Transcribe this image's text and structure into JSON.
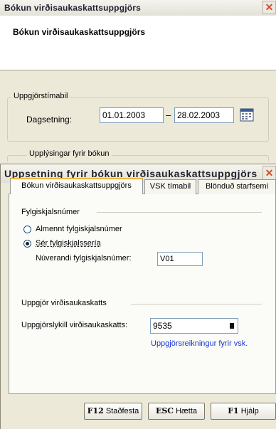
{
  "back_window": {
    "title": "Bókun virðisaukaskattsuppgjörs",
    "heading": "Bókun virðisaukaskattsuppgjörs",
    "period_group": "Uppgjörstímabil",
    "date_label": "Dagsetning:",
    "date_from": "01.01.2003",
    "date_separator": "–",
    "date_to": "28.02.2003",
    "info_group": "Upplýsingar fyrir bókun",
    "side_letter": "s",
    "close_glyph": "✕"
  },
  "dialog": {
    "title": "Uppsetning fyrir bókun virðisaukaskattsuppgjörs",
    "close_glyph": "✕",
    "tabs": [
      {
        "label": "Bókun virðisaukaskattsuppgjörs"
      },
      {
        "label": "VSK tímabil"
      },
      {
        "label": "Blönduð starfsemi"
      }
    ],
    "voucher_section": "Fylgiskjalsnúmer",
    "radio_general": "Almennt fylgiskjalsnúmer",
    "radio_series": "Sér fylgiskjalssería",
    "current_label": "Núverandi fylgiskjalsnúmer:",
    "current_value": "V01",
    "vat_section": "Uppgjör virðisaukaskatts",
    "key_label": "Uppgjörslykill virðisaukaskatts:",
    "key_value": "9535",
    "account_link": "Uppgjörsreikningur fyrir vsk.",
    "buttons": {
      "confirm_key": "F12",
      "confirm": "Staðfesta",
      "cancel_key": "ESC",
      "cancel": "Hætta",
      "help_key": "F1",
      "help": "Hjálp"
    },
    "selected_radio": "series"
  },
  "colors": {
    "accent_tab": "#f0b640",
    "link": "#1a35d0",
    "close": "#d24c2c"
  },
  "icons": [
    "calendar-icon",
    "close-icon",
    "lookup-button-icon"
  ]
}
